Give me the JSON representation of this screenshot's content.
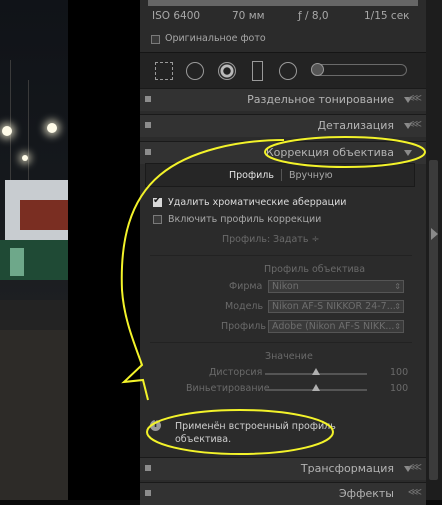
{
  "exif": {
    "iso": "ISO 6400",
    "focal": "70 мм",
    "aperture": "ƒ / 8,0",
    "shutter": "1/15 сек"
  },
  "original_photo_label": "Оригинальное фото",
  "sections": {
    "split_toning": "Раздельное тонирование",
    "detail": "Детализация",
    "lens_correction": "Коррекция объектива",
    "transform": "Трансформация",
    "effects": "Эффекты"
  },
  "tabs": {
    "profile": "Профиль",
    "manual": "Вручную"
  },
  "options": {
    "remove_ca": "Удалить хроматические аберрации",
    "enable_profile": "Включить профиль коррекции"
  },
  "profile_row": {
    "label": "Профиль:",
    "value": "Задать ÷"
  },
  "lens_profile": {
    "heading": "Профиль объектива",
    "make_label": "Фирма",
    "make_value": "Nikon",
    "model_label": "Модель",
    "model_value": "Nikon AF-S NIKKOR 24-7...",
    "profile_label": "Профиль",
    "profile_value": "Adobe (Nikon AF-S NIKK..."
  },
  "amount": {
    "heading": "Значение",
    "distortion_label": "Дисторсия",
    "distortion_value": "100",
    "distortion_level": 0.5,
    "vignetting_label": "Виньетирование",
    "vignetting_value": "100",
    "vignetting_level": 0.5
  },
  "notice": {
    "icon": "i",
    "line1": "Применён встроенный профиль",
    "line2": "объектива."
  },
  "colors": {
    "panel": "#2b2b2b",
    "annotation": "#f3f32a"
  }
}
